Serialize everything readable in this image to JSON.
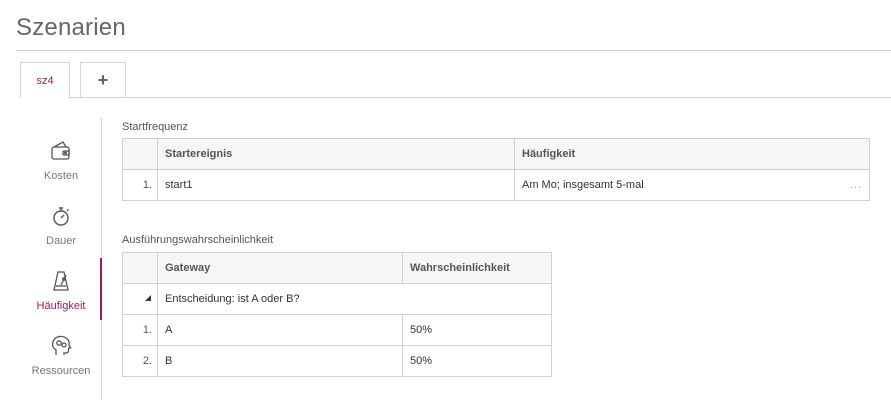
{
  "header": {
    "title": "Szenarien"
  },
  "tabs": [
    {
      "label": "sz4",
      "active": true
    },
    {
      "label": "+",
      "active": false
    }
  ],
  "sidebar": {
    "items": [
      {
        "label": "Kosten",
        "icon": "wallet-icon"
      },
      {
        "label": "Dauer",
        "icon": "stopwatch-icon"
      },
      {
        "label": "Häufigkeit",
        "icon": "metronome-icon",
        "active": true
      },
      {
        "label": "Ressourcen",
        "icon": "head-gears-icon"
      }
    ]
  },
  "startfrequency": {
    "label": "Startfrequenz",
    "columns": [
      "Startereignis",
      "Häufigkeit"
    ],
    "rows": [
      {
        "num": "1.",
        "event": "start1",
        "frequency": "Am Mo; insgesamt 5-mal",
        "more": "..."
      }
    ]
  },
  "probability": {
    "label": "Ausführungswahrscheinlichkeit",
    "columns": [
      "Gateway",
      "Wahrscheinlichkeit"
    ],
    "group": {
      "title": "Entscheidung: ist A oder B?"
    },
    "rows": [
      {
        "num": "1.",
        "gateway": "A",
        "value": "50%"
      },
      {
        "num": "2.",
        "gateway": "B",
        "value": "50%"
      }
    ]
  },
  "colors": {
    "accent": "#9b1c5e",
    "border": "#d0d0d0"
  }
}
